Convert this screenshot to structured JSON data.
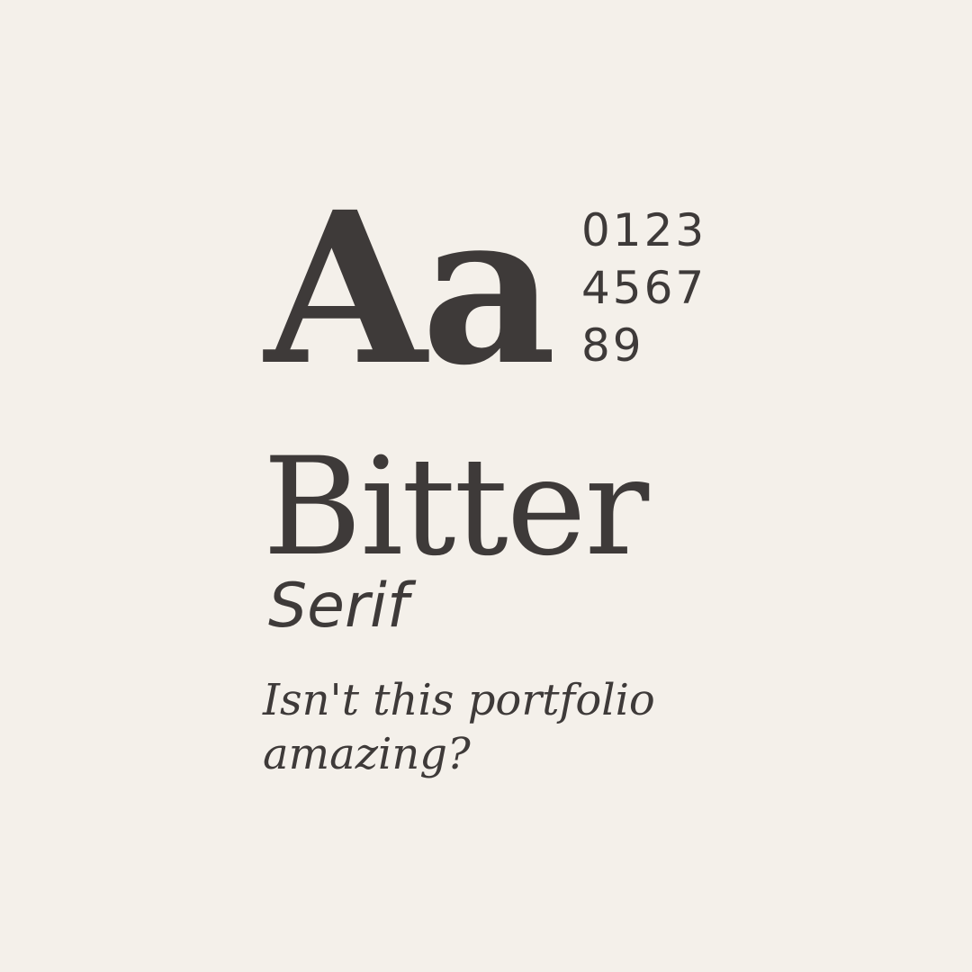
{
  "specimen": {
    "glyph_pair": "Aa",
    "numerals": [
      "0123",
      "4567",
      "89"
    ],
    "font_name": "Bitter",
    "classification": "Serif",
    "sample_lines": [
      "Isn't this portfolio",
      "amazing?"
    ]
  },
  "colors": {
    "background": "#f4f0ea",
    "text": "#3e3a39"
  }
}
